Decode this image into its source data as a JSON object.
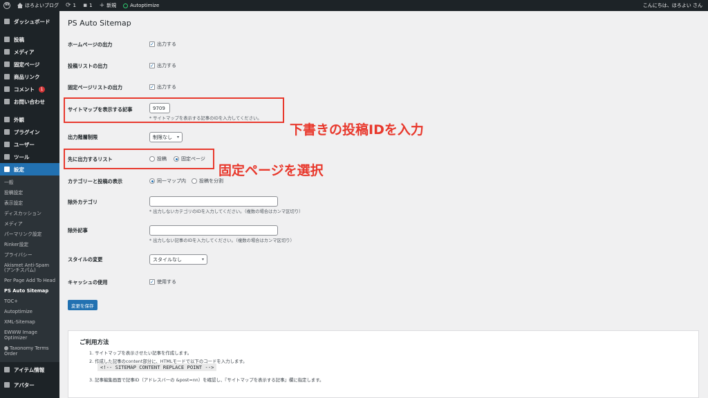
{
  "adminbar": {
    "site_name": "ほろよいブログ",
    "updates_count": "1",
    "comments_count": "1",
    "new_label": "新規",
    "autoptimize_label": "Autoptimize",
    "greeting": "こんにちは、ほろよい さん"
  },
  "sidebar": {
    "dashboard": "ダッシュボード",
    "posts": "投稿",
    "media": "メディア",
    "pages": "固定ページ",
    "product_links": "商品リンク",
    "comments": "コメント",
    "comments_badge": "1",
    "contact": "お問い合わせ",
    "appearance": "外観",
    "plugins": "プラグイン",
    "users": "ユーザー",
    "tools": "ツール",
    "settings": "設定",
    "submenu": [
      "一般",
      "投稿設定",
      "表示設定",
      "ディスカッション",
      "メディア",
      "パーマリンク設定",
      "Rinker設定",
      "プライバシー",
      "Akismet Anti-Spam (アンチスパム)",
      "Per Page Add To Head",
      "PS Auto Sitemap",
      "TOC+",
      "Autoptimize",
      "XML-Sitemap",
      "EWWW Image Optimizer",
      "Taxonomy Terms Order"
    ],
    "item_info": "アイテム情報",
    "avatar": "アバター"
  },
  "page": {
    "title": "PS Auto Sitemap",
    "rows": {
      "home_output": "ホームページの出力",
      "post_list_output": "投稿リストの出力",
      "page_list_output": "固定ページリストの出力",
      "sitemap_post": "サイトマップを表示する記事",
      "depth_limit": "出力階層制限",
      "first_list": "先に出力するリスト",
      "category_display": "カテゴリーと投稿の表示",
      "exclude_category": "除外カテゴリ",
      "exclude_posts": "除外記事",
      "style_change": "スタイルの変更",
      "cache_use": "キャッシュの使用"
    },
    "output_label": "出力する",
    "use_label": "使用する",
    "sitemap_post_id": "9709",
    "sitemap_post_hint": "* サイトマップを表示する記事のIDを入力してください。",
    "depth_value": "制限なし",
    "radio_posts": "投稿",
    "radio_pages": "固定ページ",
    "radio_same_map": "同一マップ内",
    "radio_split": "投稿を分割",
    "exclude_category_hint": "* 出力しないカテゴリのIDを入力してください。（複数の場合はカンマ区切り）",
    "exclude_posts_hint": "* 出力しない記事のIDを入力してください。（複数の場合はカンマ区切り）",
    "style_value": "スタイルなし",
    "save_button": "変更を保存"
  },
  "usage": {
    "title": "ご利用方法",
    "step1": "1. サイトマップを表示させたい記事を作成します。",
    "step2": "2. 作成した記事のcontent部分に、HTMLモードで以下のコードを入力します。",
    "code": "<!-- SITEMAP CONTENT REPLACE POINT -->",
    "step3": "3. 記事編集画面で記事ID（アドレスバーの &post=nn）を確認し、『サイトマップを表示する記事』欄に指定します。"
  },
  "annotations": {
    "enter_draft_id": "下書きの投稿IDを入力",
    "select_pages": "固定ページを選択",
    "color": "#e8382c"
  }
}
